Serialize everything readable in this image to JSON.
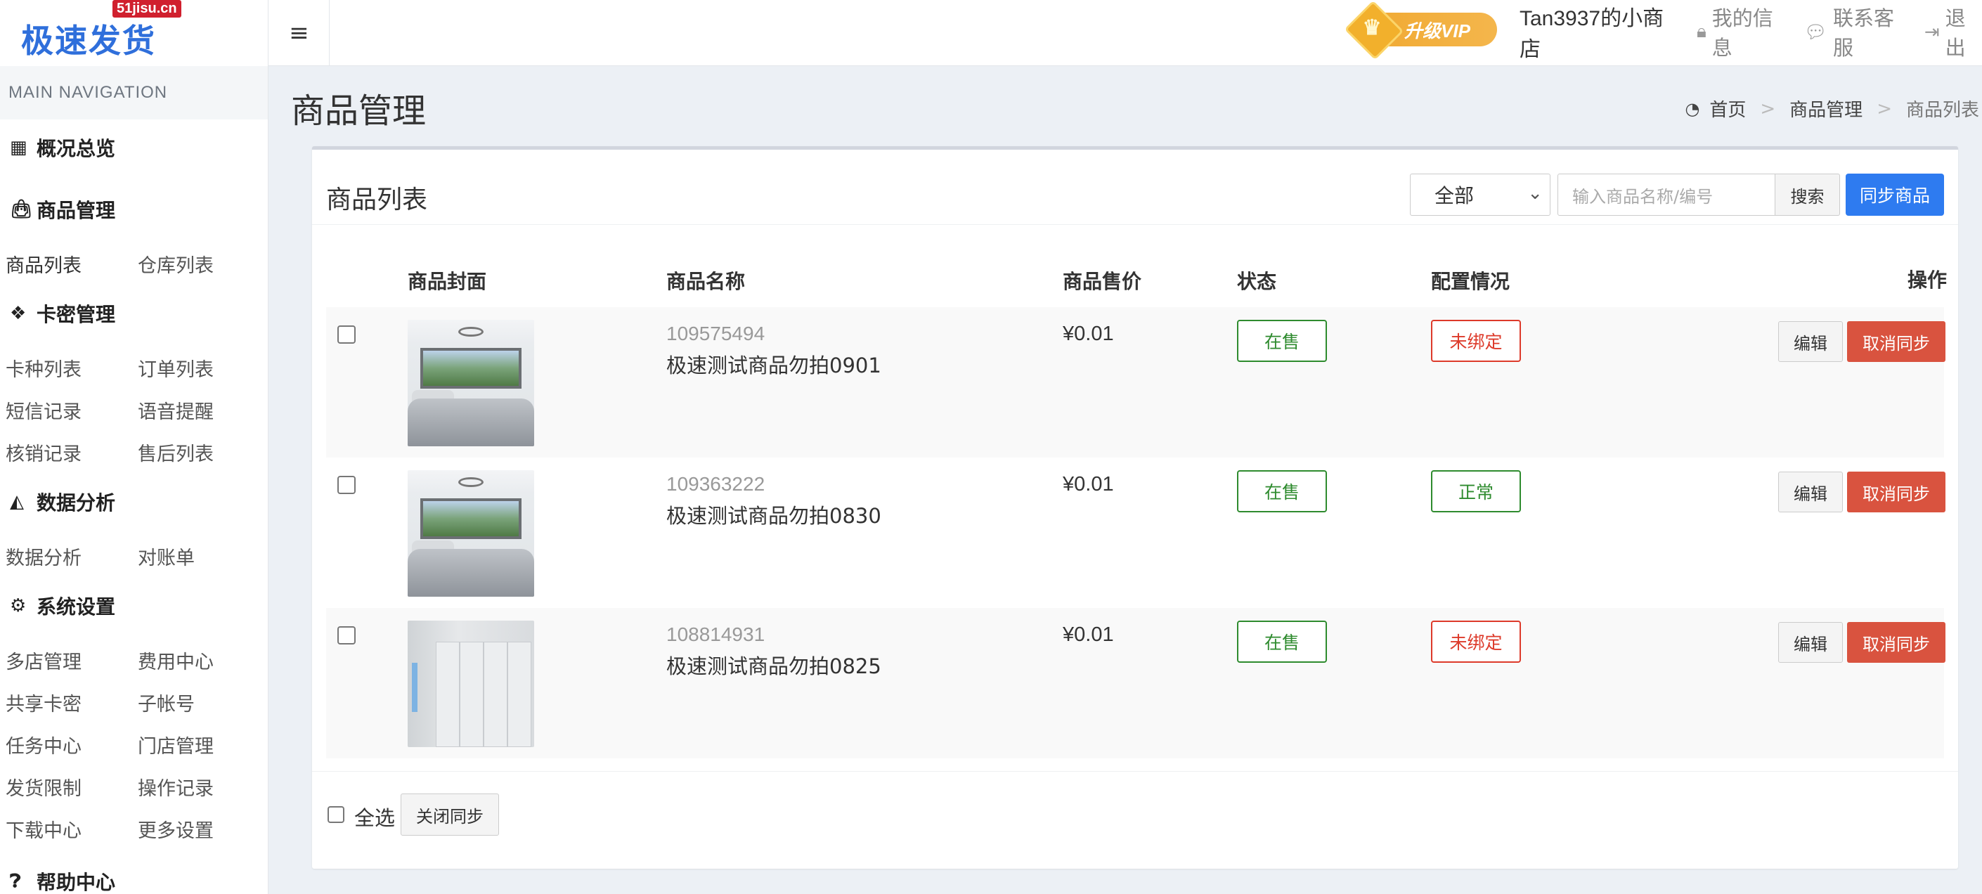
{
  "header": {
    "logo_text": "极速发货",
    "logo_tag": "51jisu.cn",
    "vip_label": "升级VIP",
    "shop_name": "Tan3937的小商店",
    "links": [
      {
        "label": "我的信息",
        "icon": "lock-icon"
      },
      {
        "label": "联系客服",
        "icon": "chat-icon"
      },
      {
        "label": "退出",
        "icon": "sign-out-icon"
      }
    ]
  },
  "sidebar": {
    "heading": "MAIN NAVIGATION",
    "overview": "概况总览",
    "sections": [
      {
        "title": "商品管理",
        "icon": "shopping-bag-icon",
        "items": [
          "商品列表",
          "仓库列表"
        ]
      },
      {
        "title": "卡密管理",
        "icon": "cubes-icon",
        "items": [
          "卡种列表",
          "订单列表",
          "短信记录",
          "语音提醒",
          "核销记录",
          "售后列表"
        ]
      },
      {
        "title": "数据分析",
        "icon": "area-chart-icon",
        "items": [
          "数据分析",
          "对账单"
        ]
      },
      {
        "title": "系统设置",
        "icon": "cogs-icon",
        "items": [
          "多店管理",
          "费用中心",
          "共享卡密",
          "子帐号",
          "任务中心",
          "门店管理",
          "发货限制",
          "操作记录",
          "下载中心",
          "更多设置"
        ]
      }
    ],
    "help": "帮助中心"
  },
  "page": {
    "title": "商品管理",
    "breadcrumb": [
      "首页",
      "商品管理",
      "商品列表"
    ]
  },
  "list": {
    "title": "商品列表",
    "filter_selected": "全部",
    "search_placeholder": "输入商品名称/编号",
    "search_label": "搜索",
    "sync_label": "同步商品",
    "columns": [
      "商品封面",
      "商品名称",
      "商品售价",
      "状态",
      "配置情况",
      "操作"
    ],
    "rows": [
      {
        "id": "109575494",
        "name": "极速测试商品勿拍0901",
        "price": "¥0.01",
        "status": "在售",
        "config": "未绑定",
        "config_color": "#dd3a2a",
        "thumb": "bedroom"
      },
      {
        "id": "109363222",
        "name": "极速测试商品勿拍0830",
        "price": "¥0.01",
        "status": "在售",
        "config": "正常",
        "config_color": "#2e8b2e",
        "thumb": "bedroom"
      },
      {
        "id": "108814931",
        "name": "极速测试商品勿拍0825",
        "price": "¥0.01",
        "status": "在售",
        "config": "未绑定",
        "config_color": "#dd3a2a",
        "thumb": "closet"
      }
    ],
    "edit_label": "编辑",
    "cancel_label": "取消同步",
    "select_all_label": "全选",
    "close_sync_label": "关闭同步"
  },
  "colors": {
    "primary": "#2e7bf0",
    "danger": "#d9533f",
    "success": "#2e8b2e",
    "vip": "#f0a830"
  }
}
